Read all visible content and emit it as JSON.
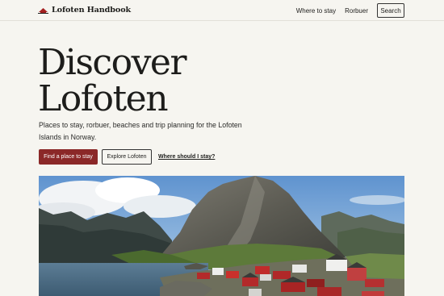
{
  "header": {
    "brand_name": "Lofoten Handbook",
    "brand_icon": "red-cabin-icon",
    "nav": [
      {
        "label": "Where to stay"
      },
      {
        "label": "Rorbuer"
      }
    ],
    "search_label": "Search"
  },
  "hero": {
    "title_line1": "Discover",
    "title_line2": "Lofoten",
    "subtitle": "Places to stay, rorbuer, beaches and trip planning for the Lofoten Islands in Norway.",
    "primary_cta": "Find a place to stay",
    "secondary_cta": "Explore Lofoten",
    "text_link": "Where should I stay?"
  },
  "image": {
    "description_icon": "lofoten-landscape-photo"
  },
  "colors": {
    "accent": "#8b2828",
    "background": "#f6f5f0",
    "text": "#1d1d1b"
  }
}
